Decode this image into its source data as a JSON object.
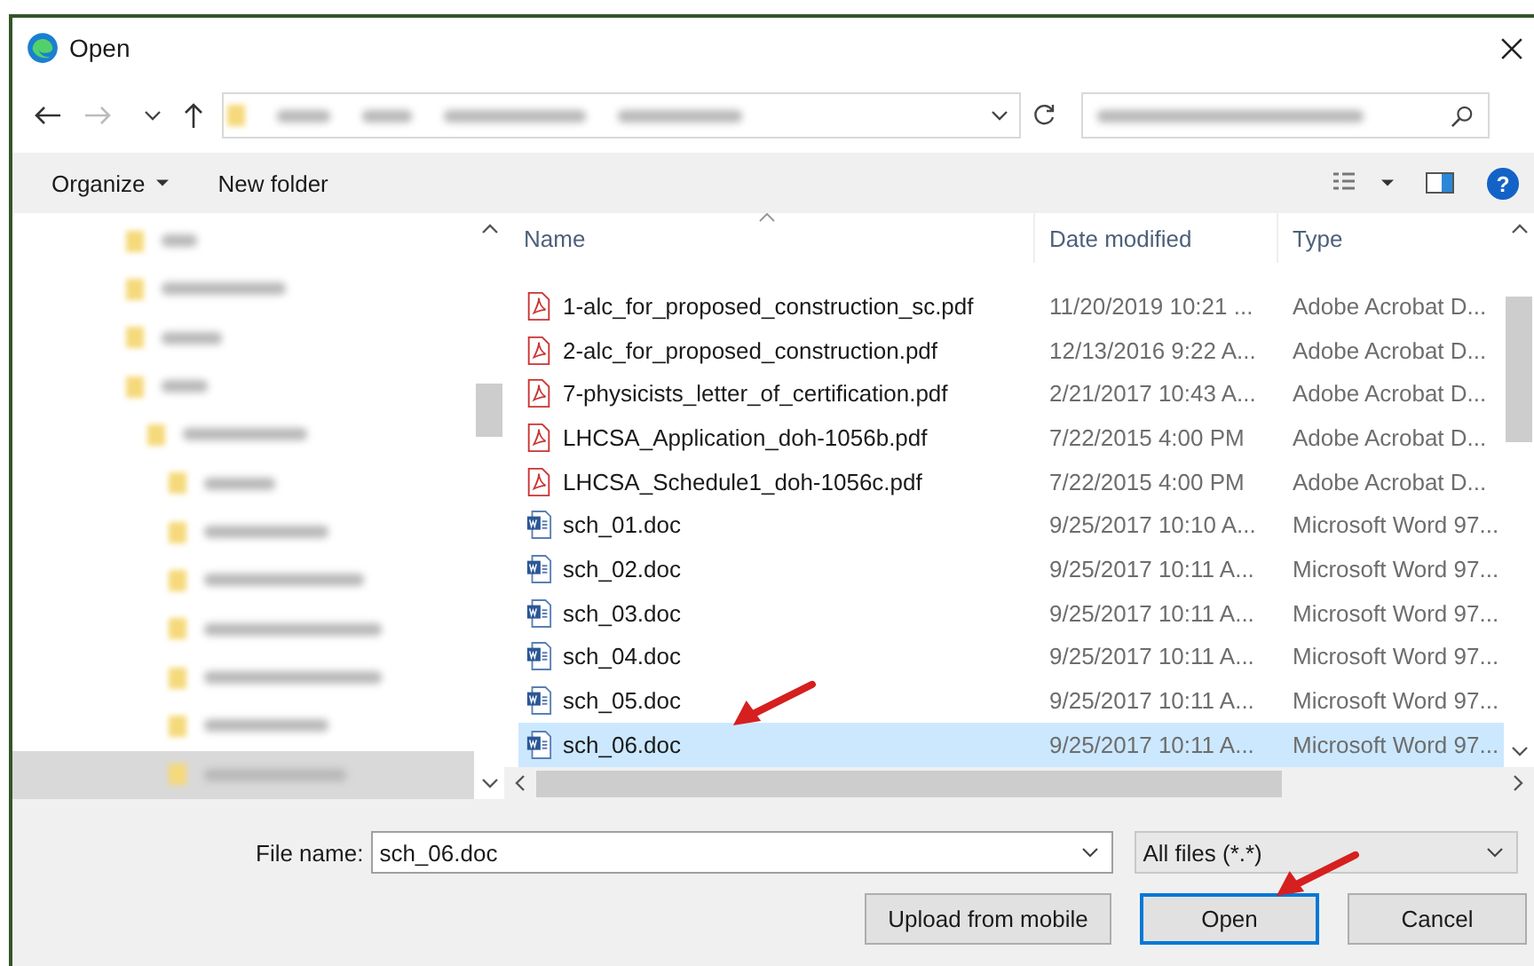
{
  "window": {
    "title": "Open"
  },
  "toolbar": {
    "organize": "Organize",
    "new_folder": "New folder",
    "help": "?"
  },
  "sidebar": {
    "items": [
      {
        "selected": false
      },
      {
        "selected": false
      },
      {
        "selected": false
      },
      {
        "selected": false,
        "children": [
          {
            "selected": false,
            "children": [
              {
                "selected": false
              },
              {
                "selected": false
              },
              {
                "selected": false
              },
              {
                "selected": false
              },
              {
                "selected": false
              },
              {
                "selected": false
              },
              {
                "selected": true
              }
            ]
          }
        ]
      }
    ]
  },
  "table": {
    "columns": [
      {
        "label": "Name",
        "sorted": true
      },
      {
        "label": "Date modified",
        "sorted": false
      },
      {
        "label": "Type",
        "sorted": false
      }
    ],
    "rows": [
      {
        "kind": "pdf",
        "name": "1-alc_for_proposed_construction_sc.pdf",
        "date": "11/20/2019 10:21 ...",
        "type": "Adobe Acrobat D...",
        "selected": false
      },
      {
        "kind": "pdf",
        "name": "2-alc_for_proposed_construction.pdf",
        "date": "12/13/2016 9:22 A...",
        "type": "Adobe Acrobat D...",
        "selected": false
      },
      {
        "kind": "pdf",
        "name": "7-physicists_letter_of_certification.pdf",
        "date": "2/21/2017 10:43 A...",
        "type": "Adobe Acrobat D...",
        "selected": false
      },
      {
        "kind": "pdf",
        "name": "LHCSA_Application_doh-1056b.pdf",
        "date": "7/22/2015 4:00 PM",
        "type": "Adobe Acrobat D...",
        "selected": false
      },
      {
        "kind": "pdf",
        "name": "LHCSA_Schedule1_doh-1056c.pdf",
        "date": "7/22/2015 4:00 PM",
        "type": "Adobe Acrobat D...",
        "selected": false
      },
      {
        "kind": "doc",
        "name": "sch_01.doc",
        "date": "9/25/2017 10:10 A...",
        "type": "Microsoft Word 97...",
        "selected": false
      },
      {
        "kind": "doc",
        "name": "sch_02.doc",
        "date": "9/25/2017 10:11 A...",
        "type": "Microsoft Word 97...",
        "selected": false
      },
      {
        "kind": "doc",
        "name": "sch_03.doc",
        "date": "9/25/2017 10:11 A...",
        "type": "Microsoft Word 97...",
        "selected": false
      },
      {
        "kind": "doc",
        "name": "sch_04.doc",
        "date": "9/25/2017 10:11 A...",
        "type": "Microsoft Word 97...",
        "selected": false
      },
      {
        "kind": "doc",
        "name": "sch_05.doc",
        "date": "9/25/2017 10:11 A...",
        "type": "Microsoft Word 97...",
        "selected": false
      },
      {
        "kind": "doc",
        "name": "sch_06.doc",
        "date": "9/25/2017 10:11 A...",
        "type": "Microsoft Word 97...",
        "selected": true
      }
    ]
  },
  "file_name": {
    "label": "File name:",
    "value": "sch_06.doc"
  },
  "file_type": {
    "value": "All files (*.*)"
  },
  "buttons": [
    {
      "label": "Upload from mobile",
      "default": false
    },
    {
      "label": "Open",
      "default": true
    },
    {
      "label": "Cancel",
      "default": false
    }
  ]
}
